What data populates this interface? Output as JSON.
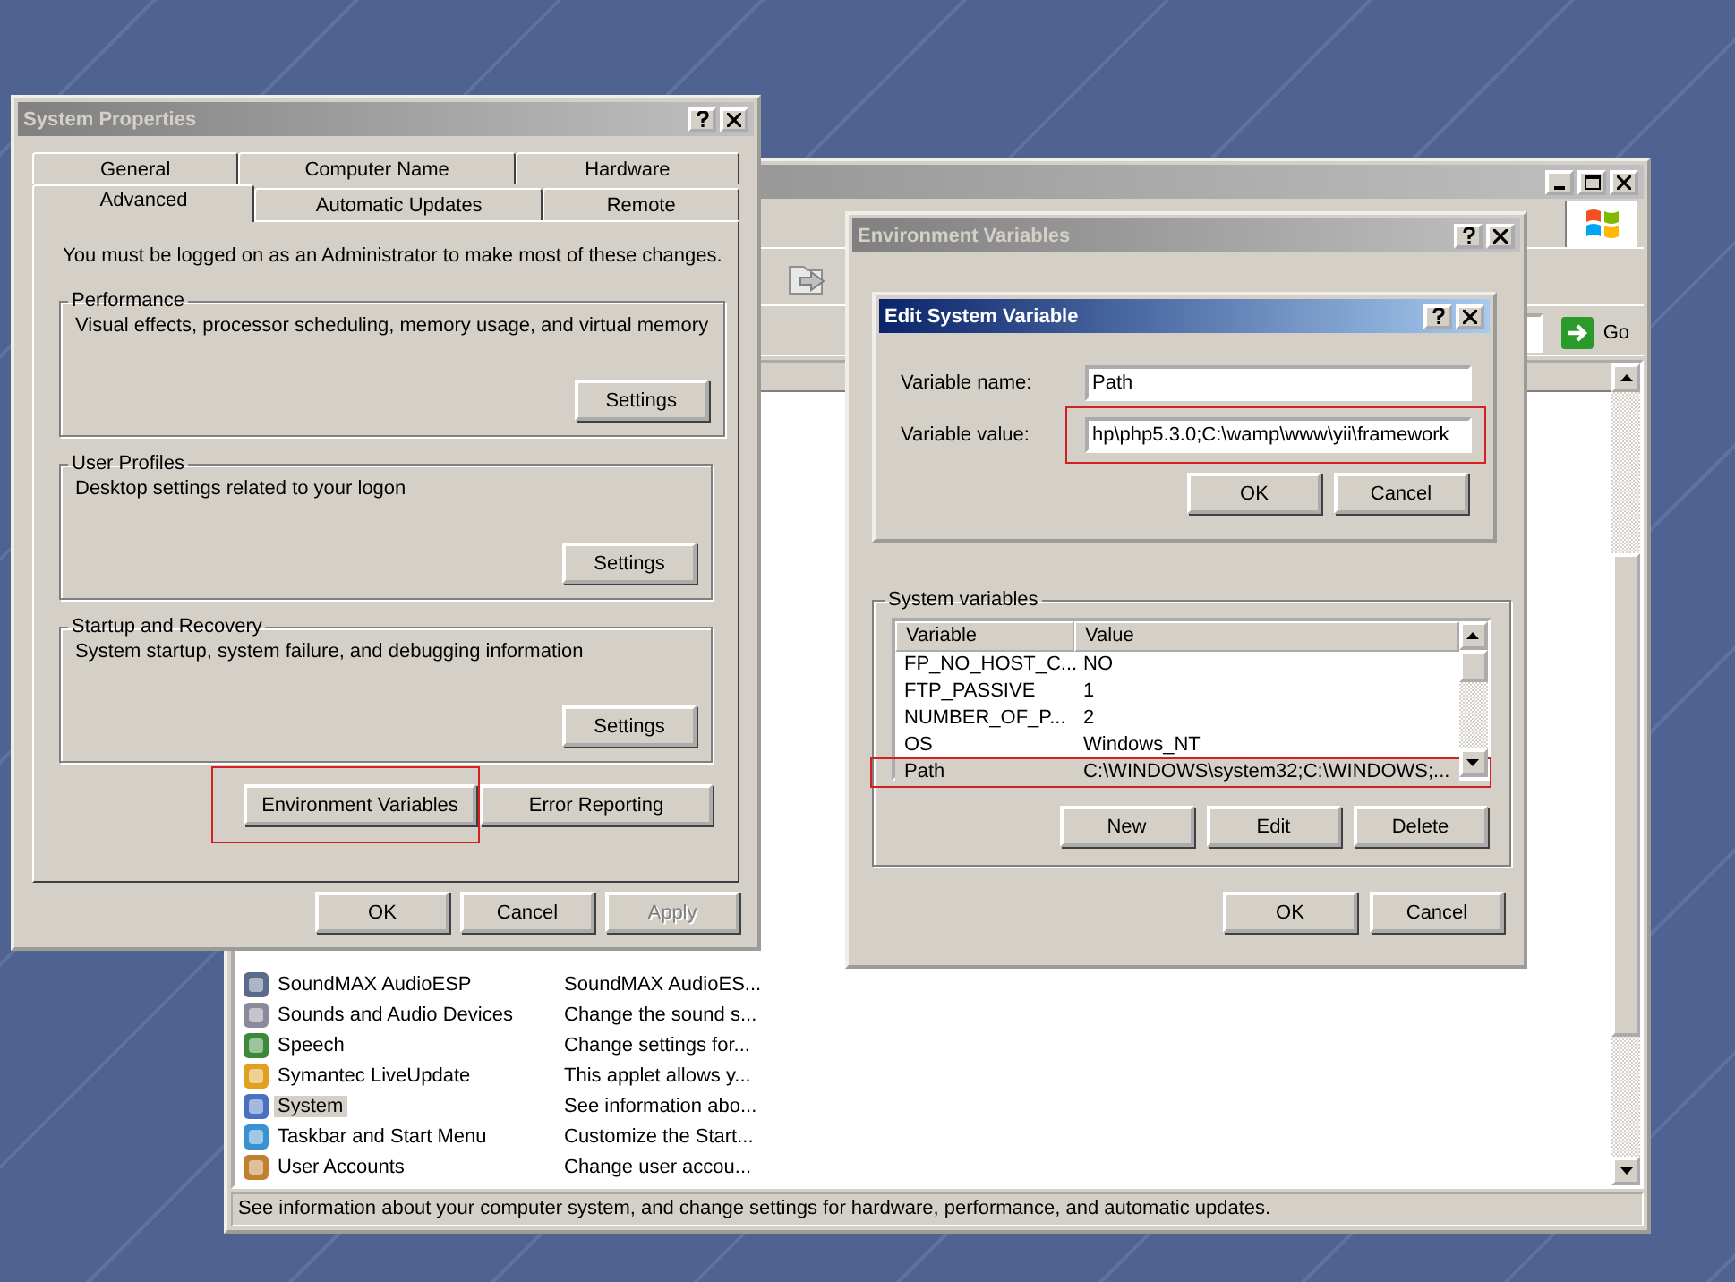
{
  "control_panel": {
    "active": false,
    "go_button": "Go",
    "items": [
      {
        "name": "SoundMAX AudioESP",
        "description": "SoundMAX AudioES...",
        "selected": false
      },
      {
        "name": "Sounds and Audio Devices",
        "description": "Change the sound s...",
        "selected": false
      },
      {
        "name": "Speech",
        "description": "Change settings for...",
        "selected": false
      },
      {
        "name": "Symantec LiveUpdate",
        "description": "This applet allows y...",
        "selected": false
      },
      {
        "name": "System",
        "description": "See information abo...",
        "selected": true
      },
      {
        "name": "Taskbar and Start Menu",
        "description": "Customize the Start...",
        "selected": false
      },
      {
        "name": "User Accounts",
        "description": "Change user accou...",
        "selected": false
      }
    ],
    "status_bar": "See information about your computer system, and change settings for hardware, performance, and automatic updates."
  },
  "system_properties": {
    "title": "System Properties",
    "active": false,
    "tab_rows": [
      [
        {
          "label": "General",
          "selected": false
        },
        {
          "label": "Computer Name",
          "selected": false
        },
        {
          "label": "Hardware",
          "selected": false
        }
      ],
      [
        {
          "label": "Advanced",
          "selected": true
        },
        {
          "label": "Automatic Updates",
          "selected": false
        },
        {
          "label": "Remote",
          "selected": false
        }
      ]
    ],
    "intro": "You must be logged on as an Administrator to make most of these changes.",
    "groups": [
      {
        "title": "Performance",
        "description": "Visual effects, processor scheduling, memory usage, and virtual memory",
        "button": "Settings"
      },
      {
        "title": "User Profiles",
        "description": "Desktop settings related to your logon",
        "button": "Settings"
      },
      {
        "title": "Startup and Recovery",
        "description": "System startup, system failure, and debugging information",
        "button": "Settings"
      }
    ],
    "extra_buttons": [
      {
        "label": "Environment Variables",
        "highlighted": true
      },
      {
        "label": "Error Reporting",
        "highlighted": false
      }
    ],
    "buttons": [
      {
        "label": "OK",
        "disabled": false
      },
      {
        "label": "Cancel",
        "disabled": false
      },
      {
        "label": "Apply",
        "disabled": true
      }
    ]
  },
  "environment_variables": {
    "title": "Environment Variables",
    "active": false,
    "system_variables": {
      "title": "System variables",
      "columns": [
        "Variable",
        "Value"
      ],
      "rows": [
        {
          "variable": "FP_NO_HOST_C...",
          "value": "NO",
          "selected": false,
          "highlighted": false
        },
        {
          "variable": "FTP_PASSIVE",
          "value": "1",
          "selected": false,
          "highlighted": false
        },
        {
          "variable": "NUMBER_OF_P...",
          "value": "2",
          "selected": false,
          "highlighted": false
        },
        {
          "variable": "OS",
          "value": "Windows_NT",
          "selected": false,
          "highlighted": false
        },
        {
          "variable": "Path",
          "value": "C:\\WINDOWS\\system32;C:\\WINDOWS;...",
          "selected": true,
          "highlighted": true
        }
      ],
      "buttons": [
        "New",
        "Edit",
        "Delete"
      ]
    },
    "buttons": [
      "OK",
      "Cancel"
    ]
  },
  "edit_system_variable": {
    "title": "Edit System Variable",
    "active": true,
    "fields": [
      {
        "label": "Variable name:",
        "value": "Path",
        "highlighted": false
      },
      {
        "label": "Variable value:",
        "value": "hp\\php5.3.0;C:\\wamp\\www\\yii\\framework",
        "highlighted": true
      }
    ],
    "buttons": [
      "OK",
      "Cancel"
    ]
  }
}
